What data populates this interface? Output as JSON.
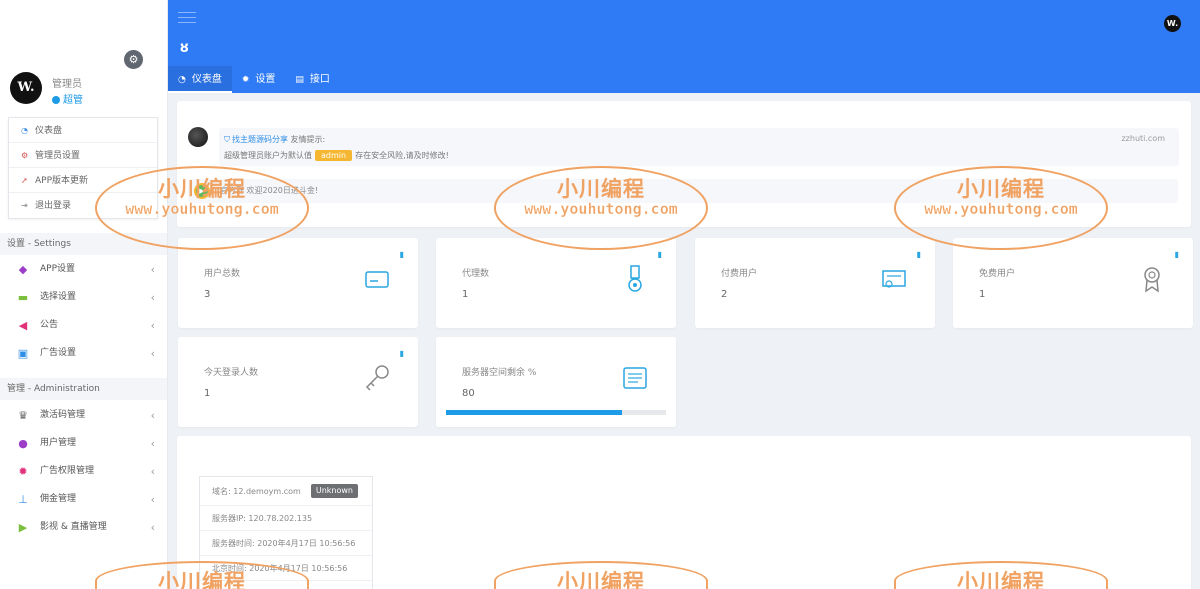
{
  "sidebar": {
    "user": {
      "avatar_text": "W.",
      "name": "管理员",
      "role": "超管"
    },
    "user_menu": [
      {
        "label": "仪表盘",
        "icon": "dashboard-icon"
      },
      {
        "label": "管理员设置",
        "icon": "cogs-icon"
      },
      {
        "label": "APP版本更新",
        "icon": "rocket-icon"
      },
      {
        "label": "退出登录",
        "icon": "logout-icon"
      }
    ],
    "section_settings": "设置 - Settings",
    "settings_items": [
      {
        "label": "APP设置",
        "icon": "android-icon",
        "color": "#9b3fc9"
      },
      {
        "label": "选择设置",
        "icon": "card-icon",
        "color": "#7cbf3d"
      },
      {
        "label": "公告",
        "icon": "megaphone-icon",
        "color": "#e0317a"
      },
      {
        "label": "广告设置",
        "icon": "image-icon",
        "color": "#2f8ee6"
      }
    ],
    "section_admin": "管理 - Administration",
    "admin_items": [
      {
        "label": "激活码管理",
        "icon": "trophy-icon",
        "color": "#666666"
      },
      {
        "label": "用户管理",
        "icon": "users-icon",
        "color": "#9b3fc9"
      },
      {
        "label": "广告权限管理",
        "icon": "gear-icon",
        "color": "#e0317a"
      },
      {
        "label": "佣金管理",
        "icon": "sitemap-icon",
        "color": "#2f8ee6"
      },
      {
        "label": "影视 & 直播管理",
        "icon": "play-icon",
        "color": "#7cbf3d"
      }
    ]
  },
  "topbar": {
    "tabs": [
      {
        "label": "仪表盘",
        "icon": "dashboard-icon"
      },
      {
        "label": "设置",
        "icon": "gear-icon"
      },
      {
        "label": "接口",
        "icon": "book-icon"
      }
    ],
    "avatar_text": "W."
  },
  "notice": {
    "link_text": "找主题源码分享",
    "title_suffix": "友情提示:",
    "source": "zzhuti.com",
    "line2_prefix": "超级管理员账户为默认值",
    "badge": "admin",
    "line2_suffix": "存在安全风险,请及时修改!",
    "row2_text": "官方群 欢迎2020日进斗金!"
  },
  "stats": [
    {
      "label": "用户总数",
      "value": "3",
      "icon": "card-icon"
    },
    {
      "label": "代理数",
      "value": "1",
      "icon": "medal-icon"
    },
    {
      "label": "付费用户",
      "value": "2",
      "icon": "certificate-icon"
    },
    {
      "label": "免费用户",
      "value": "1",
      "icon": "award-icon"
    },
    {
      "label": "今天登录人数",
      "value": "1",
      "icon": "key-icon"
    },
    {
      "label": "服务器空间剩余 %",
      "value": "80",
      "icon": "list-icon",
      "progress": 0.8
    }
  ],
  "server": {
    "domain": "域名: 12.demoym.com",
    "status": "Unknown",
    "ip": "服务器IP: 120.78.202.135",
    "server_time": "服务器时间: 2020年4月17日 10:56:56",
    "beijing_time": "北京时间: 2020年4月17日 10:56:56"
  },
  "watermark": {
    "cn": "小川编程",
    "url": "www.youhutong.com"
  },
  "colors": {
    "topbar": "#2f7bf5",
    "accent": "#1e9be6",
    "badge": "#f5b731",
    "watermark": "#f0a262"
  }
}
